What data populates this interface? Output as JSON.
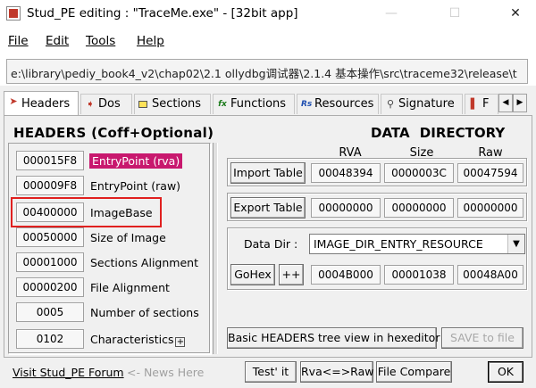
{
  "window": {
    "title": "Stud_PE editing : \"TraceMe.exe\" - [32bit app]",
    "minimize": "—",
    "maximize": "☐",
    "close": "✕"
  },
  "menu": {
    "file": "File",
    "edit": "Edit",
    "tools": "Tools",
    "help": "Help"
  },
  "path": "e:\\library\\pediy_book4_v2\\chap02\\2.1 ollydbg调试器\\2.1.4 基本操作\\src\\traceme32\\release\\t",
  "tabs": [
    {
      "label": "Headers",
      "icon": "🔖"
    },
    {
      "label": "Dos"
    },
    {
      "label": "Sections"
    },
    {
      "label": "Functions",
      "icon": "fx"
    },
    {
      "label": "Resources",
      "icon": "Rs"
    },
    {
      "label": "Signature"
    },
    {
      "label": "F"
    }
  ],
  "headers": {
    "title": "HEADERS (Coff+Optional)",
    "fields": [
      {
        "value": "000015F8",
        "label": "EntryPoint (rva)"
      },
      {
        "value": "000009F8",
        "label": "EntryPoint (raw)"
      },
      {
        "value": "00400000",
        "label": "ImageBase"
      },
      {
        "value": "00050000",
        "label": "Size of Image"
      },
      {
        "value": "00001000",
        "label": "Sections Alignment"
      },
      {
        "value": "00000200",
        "label": "File Alignment"
      },
      {
        "value": "0005",
        "label": "Number of sections"
      },
      {
        "value": "0102",
        "label": "Characteristics"
      }
    ]
  },
  "data_directory": {
    "title": "DATA  DIRECTORY",
    "col_rva": "RVA",
    "col_size": "Size",
    "col_raw": "Raw",
    "import": {
      "button": "Import Table",
      "rva": "00048394",
      "size": "0000003C",
      "raw": "00047594"
    },
    "export": {
      "button": "Export Table",
      "rva": "00000000",
      "size": "00000000",
      "raw": "00000000"
    },
    "datadir_label": "Data Dir :",
    "datadir_value": "IMAGE_DIR_ENTRY_RESOURCE",
    "gohex_button": "GoHex",
    "plusplus_button": "++",
    "gohex": {
      "rva": "0004B000",
      "size": "00001038",
      "raw": "00048A00"
    },
    "tree_button": "Basic HEADERS tree view in hexeditor",
    "save_button": "SAVE to file"
  },
  "bottom": {
    "forum_link": "Visit Stud_PE Forum",
    "news": "<- News Here",
    "testit": "Test' it",
    "rva_raw": "Rva<=>Raw",
    "file_compare": "File Compare",
    "ok": "OK"
  },
  "colors": {
    "highlight": "#c8186e",
    "annotation_box": "#e0201f"
  }
}
